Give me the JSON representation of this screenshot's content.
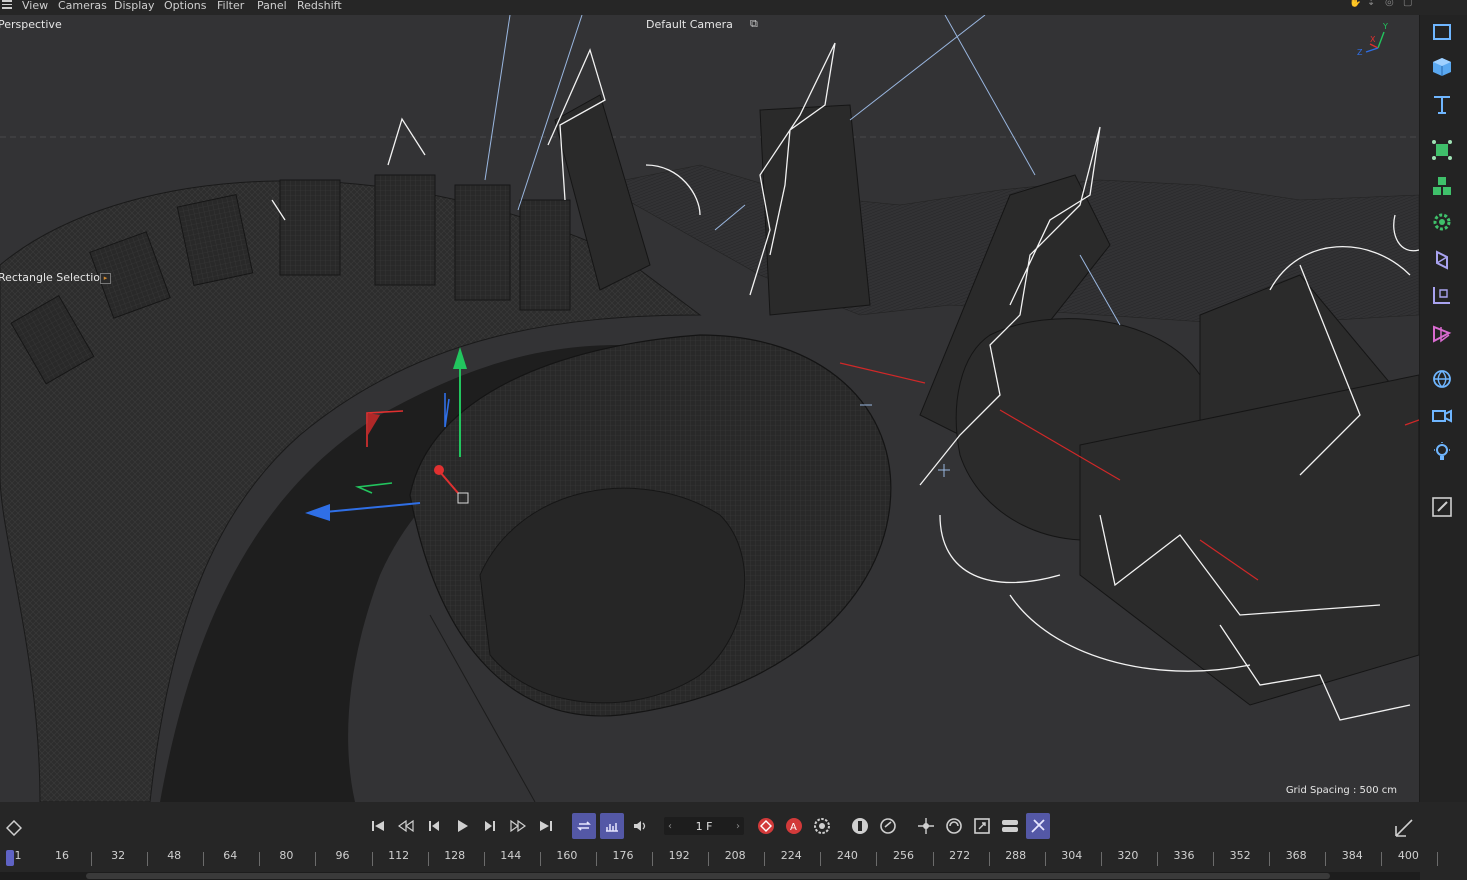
{
  "menubar": {
    "items": [
      "View",
      "Cameras",
      "Display",
      "Options",
      "Filter",
      "Panel",
      "Redshift"
    ]
  },
  "viewport": {
    "view_name": "Perspective",
    "camera_name": "Default Camera",
    "tool_label": "Rectangle Selection",
    "grid_spacing": "Grid Spacing : 500 cm",
    "axis_labels": {
      "y": "Y",
      "x": "X",
      "z": "Z"
    }
  },
  "right_toolbar": {
    "icons": [
      "view-window-icon",
      "cube-icon",
      "text-icon",
      "generator-icon",
      "cloner-icon",
      "gear-deformer-icon",
      "field-icon",
      "spline-icon",
      "hair-icon",
      "environment-icon",
      "camera-icon",
      "light-icon",
      "brush-icon"
    ]
  },
  "transport": {
    "frame": "1 F"
  },
  "timeline": {
    "ticks": [
      "1",
      "16",
      "32",
      "48",
      "64",
      "80",
      "96",
      "112",
      "128",
      "144",
      "160",
      "176",
      "192",
      "208",
      "224",
      "240",
      "256",
      "272",
      "288",
      "304",
      "320",
      "336",
      "352",
      "368",
      "384",
      "400"
    ]
  },
  "colors": {
    "accent": "#5458a6",
    "record_red": "#d23a3a",
    "axis_y": "#22c55e",
    "axis_x": "#e03030",
    "axis_z": "#2f6fe6"
  }
}
